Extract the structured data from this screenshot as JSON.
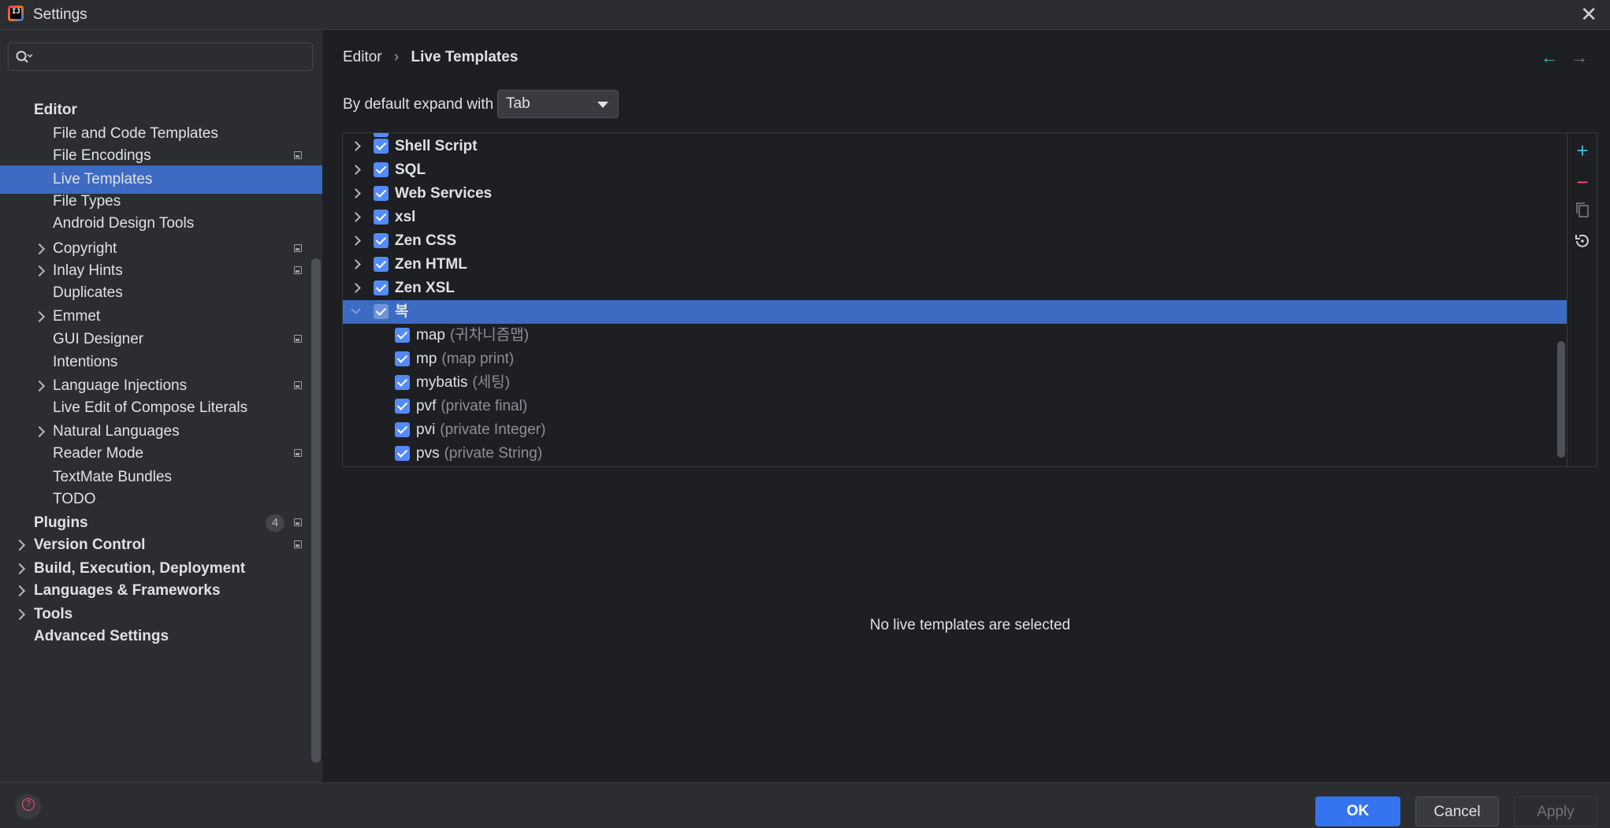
{
  "window": {
    "title": "Settings"
  },
  "search": {
    "placeholder": ""
  },
  "sidebar": {
    "items": [
      {
        "label": "Editor",
        "level": 1
      },
      {
        "label": "File and Code Templates",
        "level": 2
      },
      {
        "label": "File Encodings",
        "level": 2,
        "project": true
      },
      {
        "label": "Live Templates",
        "level": 2,
        "selected": true
      },
      {
        "label": "File Types",
        "level": 2
      },
      {
        "label": "Android Design Tools",
        "level": 2
      },
      {
        "label": "Copyright",
        "level": 2,
        "expandable": true,
        "project": true
      },
      {
        "label": "Inlay Hints",
        "level": 2,
        "expandable": true,
        "project": true
      },
      {
        "label": "Duplicates",
        "level": 2
      },
      {
        "label": "Emmet",
        "level": 2,
        "expandable": true
      },
      {
        "label": "GUI Designer",
        "level": 2,
        "project": true
      },
      {
        "label": "Intentions",
        "level": 2
      },
      {
        "label": "Language Injections",
        "level": 2,
        "expandable": true,
        "project": true
      },
      {
        "label": "Live Edit of Compose Literals",
        "level": 2
      },
      {
        "label": "Natural Languages",
        "level": 2,
        "expandable": true
      },
      {
        "label": "Reader Mode",
        "level": 2,
        "project": true
      },
      {
        "label": "TextMate Bundles",
        "level": 2
      },
      {
        "label": "TODO",
        "level": 2
      },
      {
        "label": "Plugins",
        "level": 1,
        "count": "4",
        "project": true
      },
      {
        "label": "Version Control",
        "level": 1,
        "expandable": true,
        "project": true
      },
      {
        "label": "Build, Execution, Deployment",
        "level": 1,
        "expandable": true
      },
      {
        "label": "Languages & Frameworks",
        "level": 1,
        "expandable": true
      },
      {
        "label": "Tools",
        "level": 1,
        "expandable": true
      },
      {
        "label": "Advanced Settings",
        "level": 1
      }
    ]
  },
  "breadcrumb": {
    "parent": "Editor",
    "separator": "›",
    "current": "Live Templates"
  },
  "nav": {
    "back_icon": "←",
    "forward_icon": "→"
  },
  "expand": {
    "label": "By default expand with",
    "value": "Tab"
  },
  "templates": {
    "groups": [
      {
        "name": "Shell Script",
        "checked": true
      },
      {
        "name": "SQL",
        "checked": true
      },
      {
        "name": "Web Services",
        "checked": true
      },
      {
        "name": "xsl",
        "checked": true
      },
      {
        "name": "Zen CSS",
        "checked": true
      },
      {
        "name": "Zen HTML",
        "checked": true
      },
      {
        "name": "Zen XSL",
        "checked": true
      },
      {
        "name": "복",
        "checked": true,
        "expanded": true,
        "selected": true
      }
    ],
    "items": [
      {
        "abbr": "map",
        "desc": "(귀차니즘맵)"
      },
      {
        "abbr": "mp",
        "desc": "(map print)"
      },
      {
        "abbr": "mybatis",
        "desc": "(세팅)"
      },
      {
        "abbr": "pvf",
        "desc": "(private final)"
      },
      {
        "abbr": "pvi",
        "desc": "(private Integer)"
      },
      {
        "abbr": "pvs",
        "desc": "(private String)"
      }
    ]
  },
  "toolbar": {
    "add_icon": "+",
    "remove_icon": "−"
  },
  "empty_message": "No live templates are selected",
  "buttons": {
    "ok": "OK",
    "cancel": "Cancel",
    "apply": "Apply"
  },
  "colors": {
    "accent": "#3574f0",
    "selection": "#3d6bc4",
    "checkbox": "#548af7"
  }
}
